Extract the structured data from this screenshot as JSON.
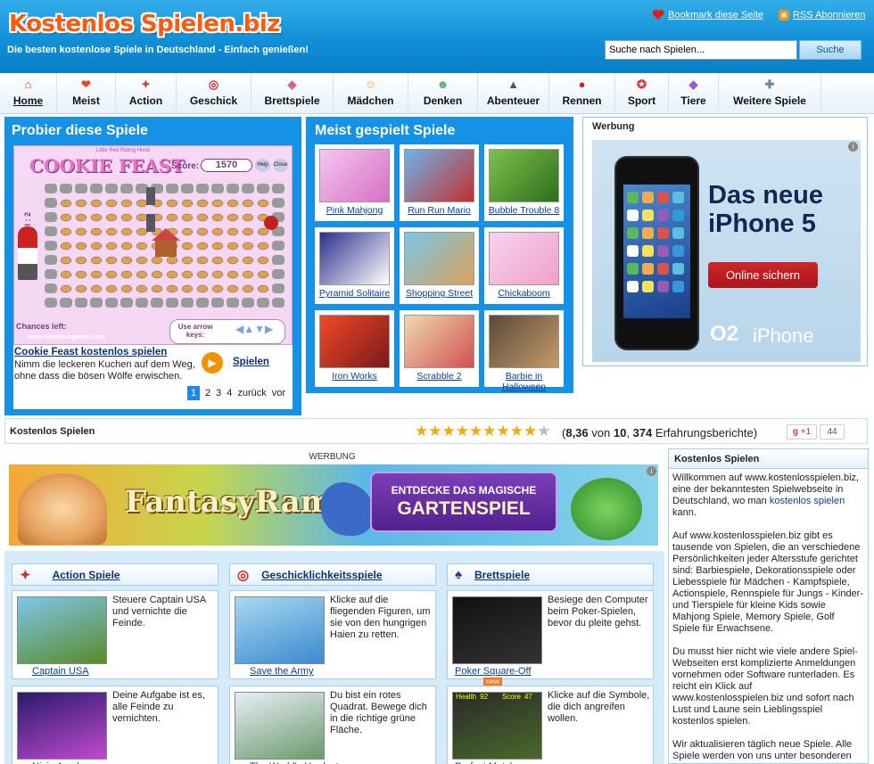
{
  "header": {
    "logo": "Kostenlos Spielen.biz",
    "tagline": "Die besten kostenlose Spiele in Deutschland - Einfach genießen!",
    "bookmark": "Bookmark diese Seite",
    "rss": "RSS Abonnieren",
    "search_placeholder": "Suche nach Spielen...",
    "search_button": "Suche"
  },
  "nav": [
    {
      "label": "Home",
      "icon": "house-icon"
    },
    {
      "label": "Meist",
      "icon": "heart-icon"
    },
    {
      "label": "Action",
      "icon": "fighter-icon"
    },
    {
      "label": "Geschick",
      "icon": "target-icon"
    },
    {
      "label": "Brettspiele",
      "icon": "board-icon"
    },
    {
      "label": "Mädchen",
      "icon": "girl-icon"
    },
    {
      "label": "Denken",
      "icon": "thinker-icon"
    },
    {
      "label": "Abenteuer",
      "icon": "assassin-icon"
    },
    {
      "label": "Rennen",
      "icon": "racer-icon"
    },
    {
      "label": "Sport",
      "icon": "sport-icon"
    },
    {
      "label": "Tiere",
      "icon": "animal-icon"
    },
    {
      "label": "Weitere Spiele",
      "icon": "gamepad-icon"
    }
  ],
  "try_panel": {
    "title": "Probier diese Spiele",
    "game_title_art": "COOKIE FEAST",
    "game_subtitle": "Little Red Riding Hood",
    "score_label": "Score:",
    "score_value": "1570",
    "btn_help": "Help",
    "btn_close": "Close",
    "level_label": "Level : 2",
    "chances_label": "Chances left:",
    "use_arrow": "Use arrow keys:",
    "site_url": "www.littlefeastgames.com",
    "game_link": "Cookie Feast kostenlos spielen",
    "game_desc": "Nimm die leckeren Kuchen auf dem Weg, ohne dass die bösen Wölfe erwischen.",
    "play_label": "Spielen",
    "pages": [
      "1",
      "2",
      "3",
      "4"
    ],
    "back": "zurück",
    "forward": "vor"
  },
  "most_played": {
    "title": "Meist gespielt Spiele",
    "games": [
      "Pink Mahjong",
      "Run Run Mario",
      "Bubble Trouble 8",
      "Pyramid Solitaire",
      "Shopping Street",
      "Chickaboom",
      "Iron Works",
      "Scrabble 2",
      "Barbie in Halloween"
    ]
  },
  "ad_box": {
    "label": "Werbung",
    "headline1": "Das neue",
    "headline2": "iPhone 5",
    "cta": "Online sichern",
    "brand": "O2",
    "brand_product": "iPhone"
  },
  "rating": {
    "label": "Kostenlos Spielen",
    "score": "8,36",
    "of": "von",
    "max": "10",
    "count": "374",
    "reviews_label": "Erfahrungsberichte)",
    "gplus": "+1",
    "gplus_count": "44",
    "stars_value": 8.36
  },
  "werbung2": {
    "label": "WERBUNG",
    "brand": "FantasyRama",
    "cta_line1": "ENTDECKE DAS MAGISCHE",
    "cta_line2": "GARTENSPIEL"
  },
  "categories": [
    {
      "title": "Action Spiele",
      "games": [
        {
          "name": "Captain USA",
          "desc": "Steuere Captain USA und vernichte die Feinde."
        },
        {
          "name": "Ninja Academy",
          "desc": "Deine Aufgabe ist es, alle Feinde zu vernichten."
        }
      ]
    },
    {
      "title": "Geschicklichkeitsspiele",
      "games": [
        {
          "name": "Save the Army",
          "desc": "Klicke auf die fliegenden Figuren, um sie von den hungrigen Haien zu retten."
        },
        {
          "name": "The World's Hardest",
          "desc": "Du bist ein rotes Quadrat. Bewege dich in die richtige grüne Fläche."
        }
      ]
    },
    {
      "title": "Brettspiele",
      "games": [
        {
          "name": "Poker Square-Off",
          "badge": "new",
          "desc": "Besiege den Computer beim Poker-Spielen, bevor du pleite gehst."
        },
        {
          "name": "Perfect Match",
          "desc": "Klicke auf die Symbole, die dich angreifen wollen.",
          "hud_health": "Health",
          "hud_health_val": "92",
          "hud_score": "Score",
          "hud_score_val": "47"
        }
      ]
    }
  ],
  "right_box": {
    "title": "Kostenlos Spielen",
    "p1_pre": "Willkommen auf www.kostenlosspielen.biz, eine der bekanntesten Spielwebseite in Deutschland, wo man ",
    "p1_link": "kostenlos spielen",
    "p1_post": " kann.",
    "p2": "Auf www.kostenlosspielen.biz gibt es tausende von Spielen, die an verschiedene Persönlichkeiten jeder Altersstufe gerichtet sind: Barbiespiele, Dekorationsspiele oder Liebesspiele für Mädchen - Kampfspiele, Actionspiele, Rennspiele für Jungs - Kinder- und Tierspiele für kleine Kids sowie Mahjong Spiele, Memory Spiele, Golf Spiele für Erwachsene.",
    "p3": "Du musst hier nicht wie viele andere Spiel-Webseiten erst komplizierte Anmeldungen vornehmen oder Software runterladen. Es reicht ein Klick auf www.kostenlosspielen.biz und sofort nach Lust und Laune sein Lieblingsspiel kostenlos spielen.",
    "p4": "Wir aktualisieren täglich neue Spiele. Alle Spiele werden von uns unter besonderen Voraussetzungen ausgewählt, um für euch die besten und sichersten Spiele zu garantieren."
  },
  "colors": {
    "header": "#0f8dd6",
    "panel": "#1592e6",
    "logo": "#ff5b0f",
    "star": "#f1a90c",
    "cta": "#c0171b"
  }
}
